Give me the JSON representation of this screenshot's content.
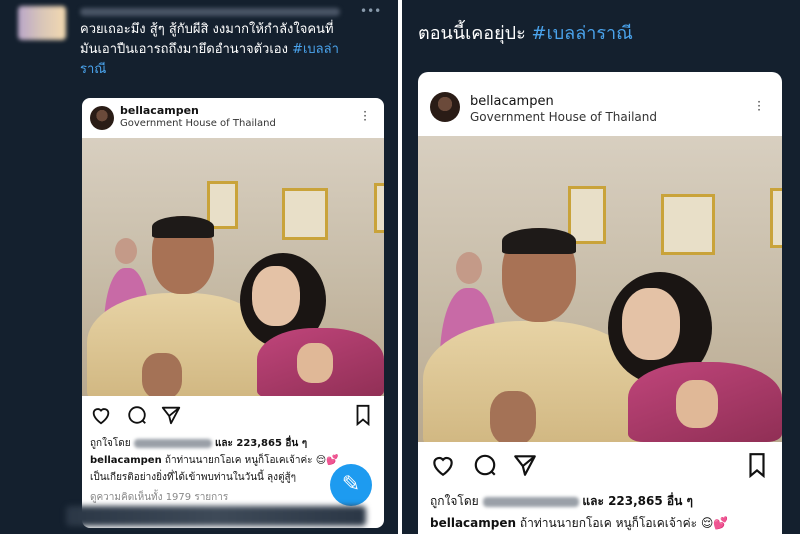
{
  "left_tweet": {
    "line1": "ควยเถอะมึง สู้ๆ สู้กับผีสิ งงมากให้กำลังใจคนที่",
    "line2": "มันเอาปืนเอารถถึงมายึดอำนาจตัวเอง",
    "hashtag_a": "#เบลล่า",
    "hashtag_b": "ราณี"
  },
  "right_tweet": {
    "text": "ตอนนี้เคอยุ่ปะ",
    "hashtag": "#เบลล่าราณี"
  },
  "instagram_post": {
    "username": "bellacampen",
    "location": "Government House of Thailand",
    "likes_prefix": "ถูกใจโดย",
    "likes_count": "และ 223,865 อื่น ๆ",
    "caption_user": "bellacampen",
    "caption_text": "ถ้าท่านนายกโอเค หนูก็โอเคเจ้าค่ะ",
    "caption_line2": "เป็นเกียรติอย่างยิ่งที่ได้เข้าพบท่านในวันนี้ ลุงตู่สู้ๆ",
    "comments_text": "ดูความคิดเห็นทั้ง 1979 รายการ"
  },
  "icons": {
    "heart": "heart-icon",
    "comment": "comment-icon",
    "share": "send-icon",
    "bookmark": "bookmark-icon",
    "more": "more-icon",
    "compose": "compose-tweet-icon"
  },
  "colors": {
    "twitter_bg": "#14202e",
    "hashtag": "#4aa3ec",
    "fab": "#1d9bf0"
  }
}
